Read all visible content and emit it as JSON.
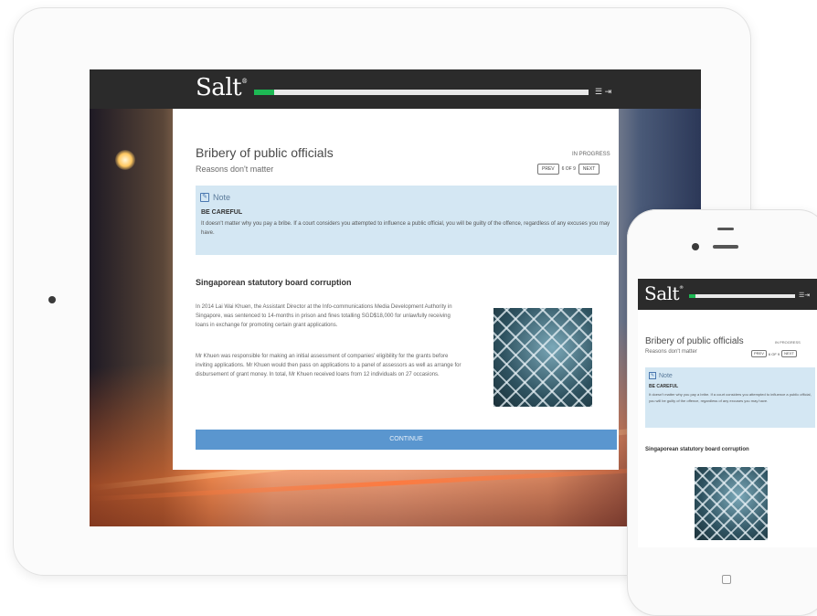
{
  "app": {
    "logo": "Salt",
    "logo_mark": "®",
    "progress_fraction": 0.06
  },
  "colors": {
    "topbar": "#2b2b2b",
    "progress_fill": "#1db954",
    "note_background": "#d4e7f3",
    "continue_button": "#5a96cf"
  },
  "icons": {
    "menu": "menu-icon",
    "exit": "exit-icon",
    "note": "edit-note-icon",
    "home": "home-button-icon"
  },
  "lesson": {
    "title": "Bribery of public officials",
    "subtitle": "Reasons don't matter",
    "status": "IN PROGRESS",
    "prev_label": "PREV",
    "next_label": "NEXT",
    "page_count": "6 OF 9"
  },
  "note": {
    "heading": "Note",
    "careful": "BE CAREFUL",
    "text": "It doesn't matter why you pay a bribe. If a court considers you attempted to influence a public official, you will be guilty of the offence, regardless of any excuses you may have."
  },
  "case": {
    "title": "Singaporean statutory board corruption",
    "paragraph_1": "In 2014 Lai Wai Khuen, the Assistant Director at the Info-communications Media Development Authority in Singapore, was sentenced to 14-months in prison and fines totalling SGD$18,000 for unlawfully receiving loans in exchange for promoting certain grant applications.",
    "paragraph_2": "Mr Khuen was responsible for making an initial assessment of companies' eligibility for the grants before inviting applications. Mr Khuen would then pass on applications to a panel of assessors as well as arrange for disbursement of grant money. In total, Mr Khuen received loans from 12 individuals on 27 occasions."
  },
  "continue_label": "CONTINUE",
  "mobile": {
    "page_count": "6 OF 9"
  }
}
